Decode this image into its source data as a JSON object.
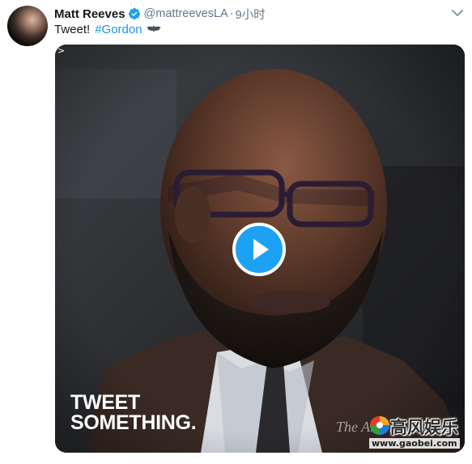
{
  "tweet": {
    "author_name": "Matt Reeves",
    "handle": "@mattreevesLA",
    "separator": "·",
    "time": "9小时",
    "text": "Tweet!",
    "hashtag": "#Gordon"
  },
  "media": {
    "gif_indicator": ">",
    "caption_lines": [
      "TWEET",
      "SOMETHING."
    ],
    "source_watermark": "The Atlan"
  },
  "watermark": {
    "site_name": "高风娱乐",
    "url": "www.gaobei.com"
  },
  "colors": {
    "link": "#1b95e0",
    "verified": "#1da1f2",
    "play_button": "#1da1f2",
    "text": "#14171a",
    "secondary_text": "#657786"
  },
  "icons": {
    "verified": "verified-badge-icon",
    "caret": "chevron-down-icon",
    "bat": "bat-emoji-icon",
    "play": "play-icon"
  }
}
